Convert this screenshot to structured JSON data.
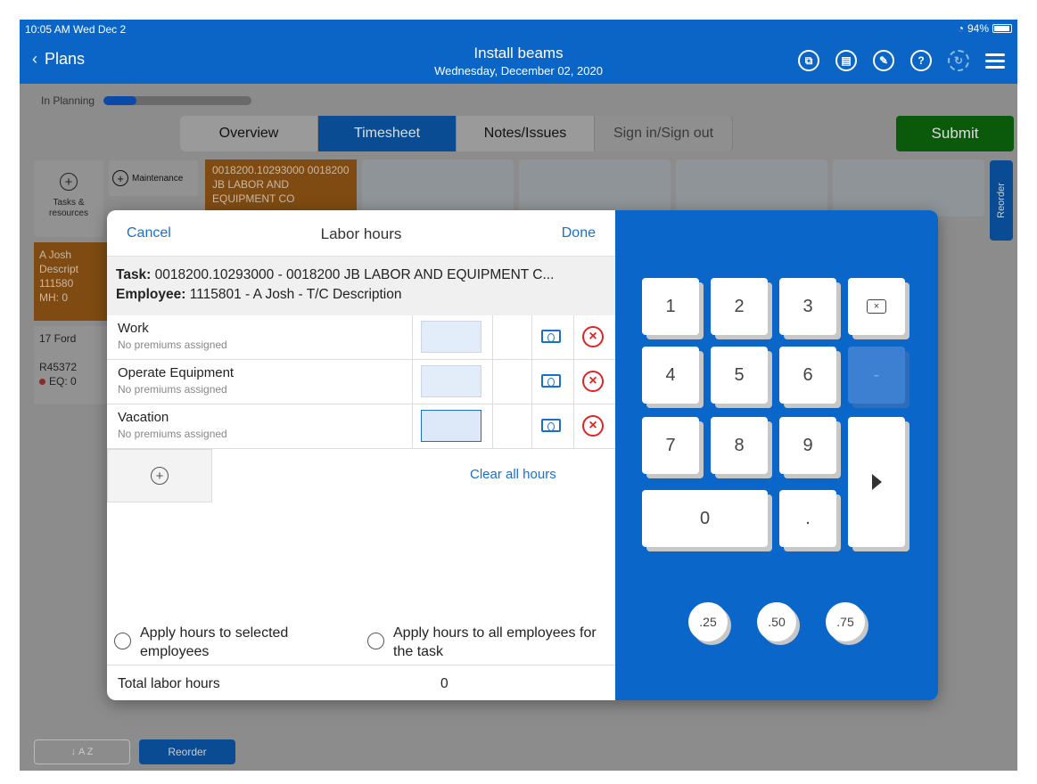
{
  "status": {
    "time": "10:05 AM  Wed Dec 2",
    "battery": "94%"
  },
  "header": {
    "back_label": "Plans",
    "title": "Install beams",
    "subtitle": "Wednesday, December 02, 2020",
    "icons": [
      "copy-icon",
      "trash-icon",
      "edit-icon",
      "help-icon",
      "refresh-icon",
      "menu-icon"
    ]
  },
  "planning": {
    "label": "In Planning",
    "progress": 0.22
  },
  "tabs": [
    "Overview",
    "Timesheet",
    "Notes/Issues",
    "Sign in/Sign out"
  ],
  "active_tab": "Timesheet",
  "submit_label": "Submit",
  "background": {
    "tasks_label": "Tasks &\nresources",
    "maintenance_label": "Maintenance",
    "task_card": "0018200.10293000 0018200 JB LABOR AND EQUIPMENT CO",
    "reorder_side": "Reorder",
    "employee_card": {
      "name": "A Josh",
      "desc": "Descript",
      "id": "111580",
      "mh": "MH: 0"
    },
    "equipment_card": {
      "name": "17 Ford",
      "id": "R45372",
      "eq": "EQ: 0"
    },
    "sort_label": "A Z",
    "reorder_bottom": "Reorder"
  },
  "modal": {
    "cancel": "Cancel",
    "title": "Labor hours",
    "done": "Done",
    "task_label": "Task:",
    "task_value": "0018200.10293000 - 0018200 JB LABOR AND EQUIPMENT C...",
    "employee_label": "Employee:",
    "employee_value": "1115801 - A Josh - T/C Description",
    "rows": [
      {
        "name": "Work",
        "sub": "No premiums assigned"
      },
      {
        "name": "Operate Equipment",
        "sub": "No premiums assigned"
      },
      {
        "name": "Vacation",
        "sub": "No premiums assigned"
      }
    ],
    "clear_all": "Clear all hours",
    "apply_selected": "Apply hours to selected employees",
    "apply_all": "Apply hours to all employees for the task",
    "total_label": "Total labor hours",
    "total_value": "0"
  },
  "keypad": {
    "digits": [
      "1",
      "2",
      "3",
      "4",
      "5",
      "6",
      "7",
      "8",
      "9",
      "0",
      "."
    ],
    "minus": "-",
    "fractions": [
      ".25",
      ".50",
      ".75"
    ]
  }
}
